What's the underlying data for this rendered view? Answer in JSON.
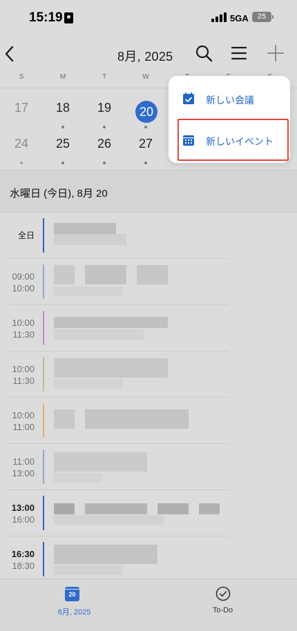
{
  "status_bar": {
    "time": "15:19",
    "network": "5GA",
    "battery": "25"
  },
  "header": {
    "month_title": "8月, 2025"
  },
  "week": {
    "weekdays": [
      "S",
      "M",
      "T",
      "W",
      "T",
      "F",
      "S"
    ],
    "row1": [
      "17",
      "18",
      "19",
      "20"
    ],
    "row2": [
      "24",
      "25",
      "26",
      "27"
    ]
  },
  "agenda": {
    "section_title": "水曜日 (今日), 8月 20",
    "all_day_label": "全日",
    "events": [
      {
        "start": "09:00",
        "end": "10:00",
        "color": "#8ea8d6"
      },
      {
        "start": "10:00",
        "end": "11:30",
        "color": "#b98ad3"
      },
      {
        "start": "10:00",
        "end": "11:30",
        "color": "#a9c98a"
      },
      {
        "start": "10:00",
        "end": "11:00",
        "color": "#e2b06e"
      },
      {
        "start": "11:00",
        "end": "13:00",
        "color": "#8ea8d6"
      },
      {
        "start": "13:00",
        "end": "16:00",
        "color": "#2f5fb8"
      },
      {
        "start": "16:30",
        "end": "18:30",
        "color": "#2f5fb8"
      }
    ],
    "all_day_color": "#2f5fb8"
  },
  "popup": {
    "items": [
      {
        "label": "新しい会議",
        "icon": "calendar-check-icon"
      },
      {
        "label": "新しいイベント",
        "icon": "calendar-grid-icon"
      }
    ],
    "highlight_color": "#e3463a",
    "accent_color": "#2266c4"
  },
  "tab_bar": {
    "calendar_icon_day": "20",
    "calendar_label": "8月, 2025",
    "todo_label": "To-Do"
  }
}
